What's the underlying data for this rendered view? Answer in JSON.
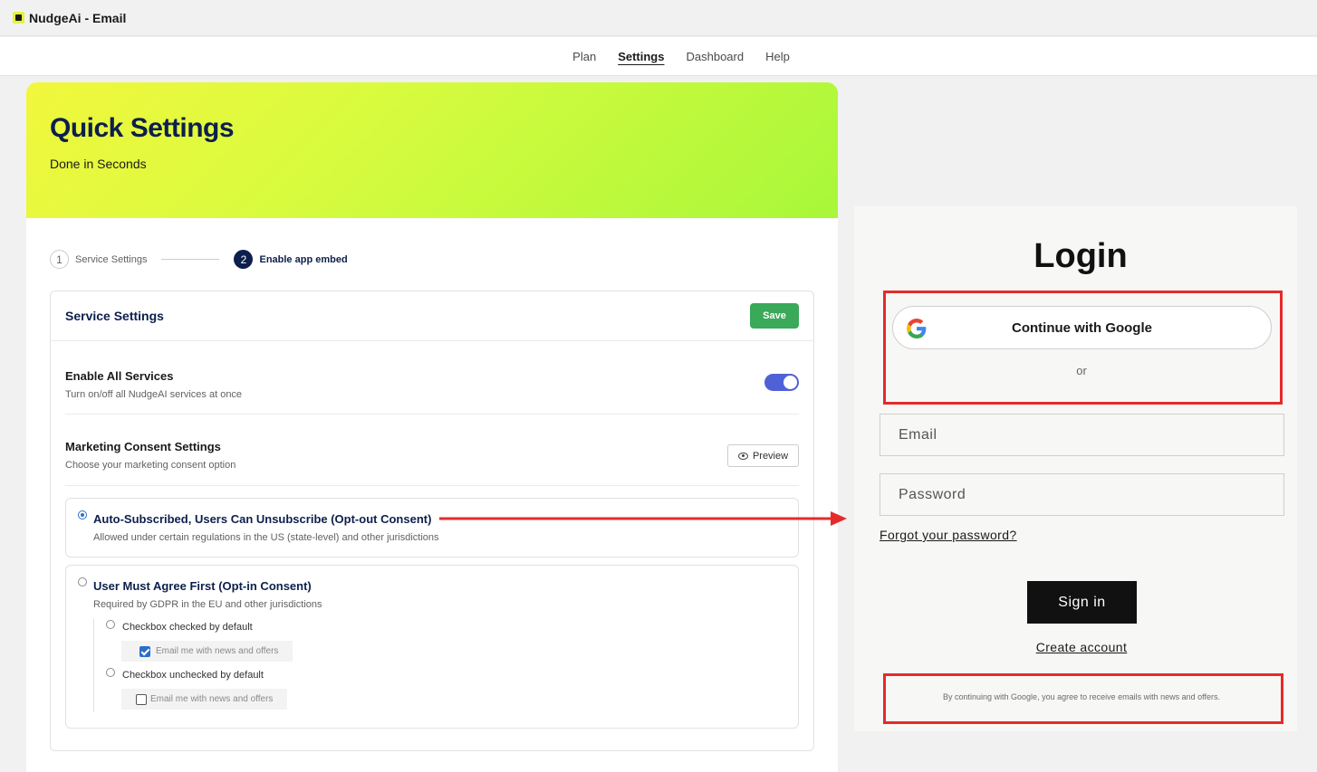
{
  "window": {
    "title": "NudgeAi - Email"
  },
  "nav": {
    "items": [
      "Plan",
      "Settings",
      "Dashboard",
      "Help"
    ],
    "active": "Settings"
  },
  "hero": {
    "title": "Quick Settings",
    "subtitle": "Done in Seconds"
  },
  "stepper": {
    "steps": [
      {
        "number": "1",
        "label": "Service Settings",
        "state": "done"
      },
      {
        "number": "2",
        "label": "Enable app embed",
        "state": "current"
      }
    ]
  },
  "service_settings": {
    "title": "Service Settings",
    "save_label": "Save",
    "enable_all": {
      "title": "Enable All Services",
      "subtitle": "Turn on/off all NudgeAI services at once",
      "enabled": true
    },
    "marketing": {
      "title": "Marketing Consent Settings",
      "subtitle": "Choose your marketing consent option",
      "preview_label": "Preview"
    },
    "opt_out": {
      "title": "Auto-Subscribed, Users Can Unsubscribe (Opt-out Consent)",
      "subtitle": "Allowed under certain regulations in the US (state-level) and other jurisdictions",
      "selected": true
    },
    "opt_in": {
      "title": "User Must Agree First (Opt-in Consent)",
      "subtitle": "Required by GDPR in the EU and other jurisdictions",
      "selected": false,
      "checked_default": {
        "label": "Checkbox checked by default",
        "sample": "Email me with news and offers"
      },
      "unchecked_default": {
        "label": "Checkbox unchecked by default",
        "sample": "Email me with news and offers"
      }
    }
  },
  "login": {
    "title": "Login",
    "google_label": "Continue with Google",
    "or_label": "or",
    "email_placeholder": "Email",
    "password_placeholder": "Password",
    "forgot_label": "Forgot your password?",
    "signin_label": "Sign in",
    "create_label": "Create account",
    "agree_text": "By continuing with Google, you agree to receive emails with news and offers."
  },
  "colors": {
    "accent_blue": "#4f61d6",
    "save_green": "#3aa959",
    "navy": "#0d1f4c",
    "highlight_red": "#e62a2a"
  }
}
